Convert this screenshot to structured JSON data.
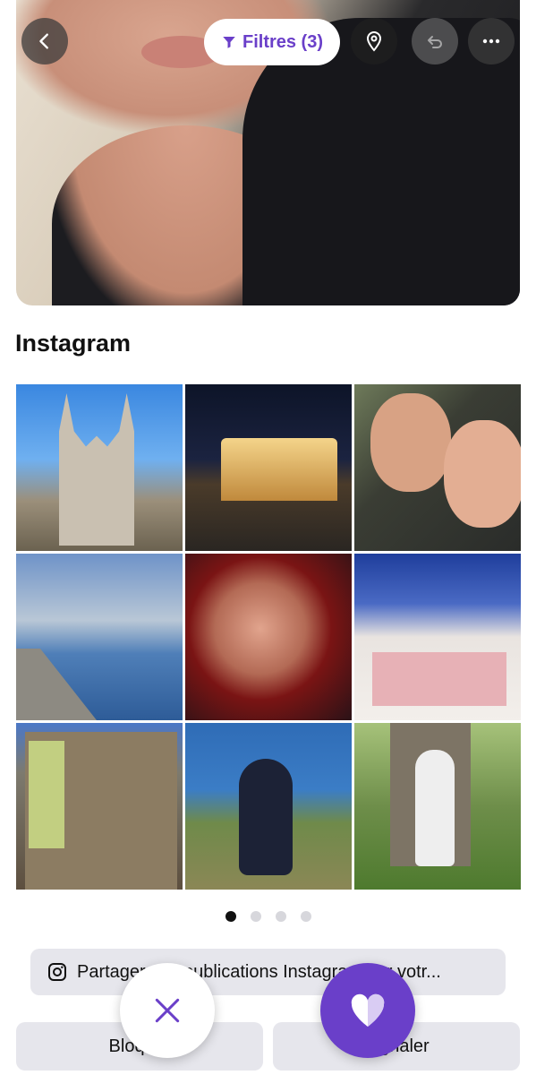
{
  "header": {
    "filters_label": "Filtres (3)",
    "icons": {
      "back": "chevron-left-icon",
      "filter": "filter-icon",
      "location": "location-pin-icon",
      "undo": "undo-icon",
      "more": "more-dots-icon"
    }
  },
  "instagram": {
    "title": "Instagram",
    "photos": [
      "church",
      "night-building",
      "couple-selfie",
      "harbor",
      "red-hair-selfie",
      "christmas-gifts",
      "illuminated-house",
      "seaside-sitting",
      "tree-portrait"
    ],
    "pager": {
      "count": 4,
      "active": 0
    }
  },
  "actions": {
    "share_label": "Partager vos publications Instagram sur votr...",
    "block_label": "Bloquer",
    "report_label": "Signaler"
  },
  "colors": {
    "accent": "#6a3fc9",
    "button_bg": "#e6e6ec"
  }
}
